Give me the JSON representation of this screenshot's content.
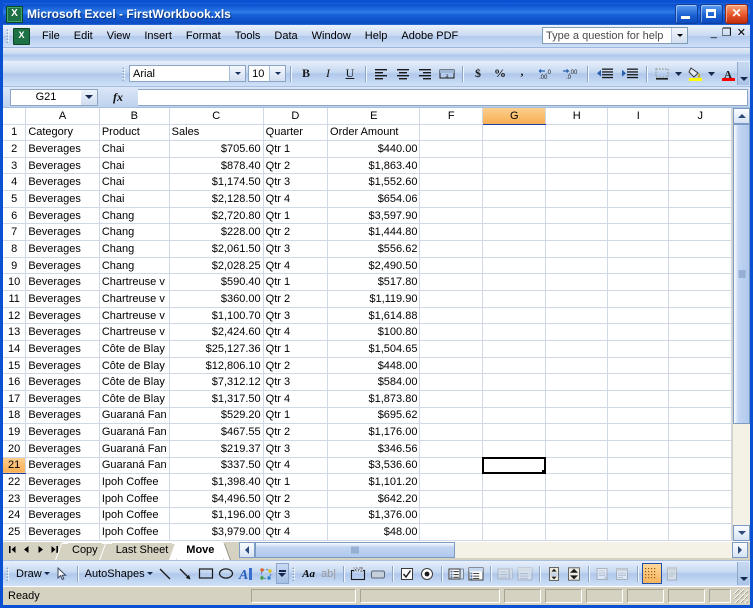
{
  "window": {
    "title": "Microsoft Excel - FirstWorkbook.xls",
    "app_icon": "excel-icon",
    "minimize_label": "Minimize",
    "maximize_label": "Restore",
    "close_label": "Close"
  },
  "menubar": {
    "items": [
      {
        "label": "File"
      },
      {
        "label": "Edit"
      },
      {
        "label": "View"
      },
      {
        "label": "Insert"
      },
      {
        "label": "Format"
      },
      {
        "label": "Tools"
      },
      {
        "label": "Data"
      },
      {
        "label": "Window"
      },
      {
        "label": "Help"
      },
      {
        "label": "Adobe PDF"
      }
    ],
    "help_box_placeholder": "Type a question for help",
    "doc_minimize": "_",
    "doc_restore": "❐",
    "doc_close": "✕"
  },
  "formatting_toolbar": {
    "font_name": "Arial",
    "font_size": "10",
    "buttons": [
      {
        "name": "bold-button",
        "glyph": "B"
      },
      {
        "name": "italic-button",
        "glyph": "I"
      },
      {
        "name": "underline-button",
        "glyph": "U"
      },
      {
        "name": "align-left-button",
        "glyph": "≡"
      },
      {
        "name": "align-center-button",
        "glyph": "≡"
      },
      {
        "name": "align-right-button",
        "glyph": "≡"
      },
      {
        "name": "merge-and-center-button",
        "glyph": "a"
      },
      {
        "name": "currency-style-button",
        "glyph": "$"
      },
      {
        "name": "percent-style-button",
        "glyph": "%"
      },
      {
        "name": "comma-style-button",
        "glyph": ","
      },
      {
        "name": "increase-decimal-button",
        "glyph": ".00"
      },
      {
        "name": "decrease-decimal-button",
        "glyph": ".0"
      },
      {
        "name": "decrease-indent-button",
        "glyph": "←"
      },
      {
        "name": "increase-indent-button",
        "glyph": "→"
      },
      {
        "name": "borders-button",
        "glyph": "▦"
      },
      {
        "name": "fill-color-button",
        "glyph": "△"
      },
      {
        "name": "font-color-button",
        "glyph": "A"
      }
    ]
  },
  "formula_bar": {
    "name_box_value": "G21",
    "fx_label": "fx",
    "formula_value": ""
  },
  "sheet": {
    "columns": [
      "A",
      "B",
      "C",
      "D",
      "E",
      "F",
      "G",
      "H",
      "I",
      "J"
    ],
    "selected_column": "G",
    "selected_row": "21",
    "selected_cell": "G21",
    "header_row": {
      "row_number": "1",
      "cells": [
        "Category",
        "Product",
        "Sales",
        "Quarter",
        "Order Amount",
        "",
        "",
        "",
        "",
        ""
      ]
    },
    "rows": [
      {
        "n": "2",
        "a": "Beverages",
        "b": "Chai",
        "c": "$705.60",
        "d": "Qtr 1",
        "e": "$440.00"
      },
      {
        "n": "3",
        "a": "Beverages",
        "b": "Chai",
        "c": "$878.40",
        "d": "Qtr 2",
        "e": "$1,863.40"
      },
      {
        "n": "4",
        "a": "Beverages",
        "b": "Chai",
        "c": "$1,174.50",
        "d": "Qtr 3",
        "e": "$1,552.60"
      },
      {
        "n": "5",
        "a": "Beverages",
        "b": "Chai",
        "c": "$2,128.50",
        "d": "Qtr 4",
        "e": "$654.06"
      },
      {
        "n": "6",
        "a": "Beverages",
        "b": "Chang",
        "c": "$2,720.80",
        "d": "Qtr 1",
        "e": "$3,597.90"
      },
      {
        "n": "7",
        "a": "Beverages",
        "b": "Chang",
        "c": "$228.00",
        "d": "Qtr 2",
        "e": "$1,444.80"
      },
      {
        "n": "8",
        "a": "Beverages",
        "b": "Chang",
        "c": "$2,061.50",
        "d": "Qtr 3",
        "e": "$556.62"
      },
      {
        "n": "9",
        "a": "Beverages",
        "b": "Chang",
        "c": "$2,028.25",
        "d": "Qtr 4",
        "e": "$2,490.50"
      },
      {
        "n": "10",
        "a": "Beverages",
        "b": "Chartreuse v",
        "c": "$590.40",
        "d": "Qtr 1",
        "e": "$517.80"
      },
      {
        "n": "11",
        "a": "Beverages",
        "b": "Chartreuse v",
        "c": "$360.00",
        "d": "Qtr 2",
        "e": "$1,119.90"
      },
      {
        "n": "12",
        "a": "Beverages",
        "b": "Chartreuse v",
        "c": "$1,100.70",
        "d": "Qtr 3",
        "e": "$1,614.88"
      },
      {
        "n": "13",
        "a": "Beverages",
        "b": "Chartreuse v",
        "c": "$2,424.60",
        "d": "Qtr 4",
        "e": "$100.80"
      },
      {
        "n": "14",
        "a": "Beverages",
        "b": "Côte de Blay",
        "c": "$25,127.36",
        "d": "Qtr 1",
        "e": "$1,504.65"
      },
      {
        "n": "15",
        "a": "Beverages",
        "b": "Côte de Blay",
        "c": "$12,806.10",
        "d": "Qtr 2",
        "e": "$448.00"
      },
      {
        "n": "16",
        "a": "Beverages",
        "b": "Côte de Blay",
        "c": "$7,312.12",
        "d": "Qtr 3",
        "e": "$584.00"
      },
      {
        "n": "17",
        "a": "Beverages",
        "b": "Côte de Blay",
        "c": "$1,317.50",
        "d": "Qtr 4",
        "e": "$1,873.80"
      },
      {
        "n": "18",
        "a": "Beverages",
        "b": "Guaraná Fan",
        "c": "$529.20",
        "d": "Qtr 1",
        "e": "$695.62"
      },
      {
        "n": "19",
        "a": "Beverages",
        "b": "Guaraná Fan",
        "c": "$467.55",
        "d": "Qtr 2",
        "e": "$1,176.00"
      },
      {
        "n": "20",
        "a": "Beverages",
        "b": "Guaraná Fan",
        "c": "$219.37",
        "d": "Qtr 3",
        "e": "$346.56"
      },
      {
        "n": "21",
        "a": "Beverages",
        "b": "Guaraná Fan",
        "c": "$337.50",
        "d": "Qtr 4",
        "e": "$3,536.60"
      },
      {
        "n": "22",
        "a": "Beverages",
        "b": "Ipoh Coffee",
        "c": "$1,398.40",
        "d": "Qtr 1",
        "e": "$1,101.20"
      },
      {
        "n": "23",
        "a": "Beverages",
        "b": "Ipoh Coffee",
        "c": "$4,496.50",
        "d": "Qtr 2",
        "e": "$642.20"
      },
      {
        "n": "24",
        "a": "Beverages",
        "b": "Ipoh Coffee",
        "c": "$1,196.00",
        "d": "Qtr 3",
        "e": "$1,376.00"
      },
      {
        "n": "25",
        "a": "Beverages",
        "b": "Ipoh Coffee",
        "c": "$3,979.00",
        "d": "Qtr 4",
        "e": "$48.00"
      }
    ]
  },
  "sheet_tabs": {
    "nav_first": "⏮",
    "nav_prev": "◀",
    "nav_next": "▶",
    "nav_last": "⏭",
    "tabs": [
      {
        "label": "Copy",
        "active": false
      },
      {
        "label": "Last Sheet",
        "active": false
      },
      {
        "label": "Move",
        "active": true
      }
    ]
  },
  "drawing_toolbar": {
    "draw_label": "Draw",
    "autoshapes_label": "AutoShapes",
    "buttons": [
      {
        "name": "select-objects-icon"
      },
      {
        "name": "line-icon"
      },
      {
        "name": "arrow-icon"
      },
      {
        "name": "rectangle-icon"
      },
      {
        "name": "oval-icon"
      },
      {
        "name": "wordart-icon"
      },
      {
        "name": "diagram-icon"
      }
    ]
  },
  "forms_toolbar": {
    "buttons": [
      {
        "name": "label-icon",
        "glyph": "Aa"
      },
      {
        "name": "edit-box-icon",
        "glyph": "ab|"
      },
      {
        "name": "group-box-icon"
      },
      {
        "name": "button-icon"
      },
      {
        "name": "check-box-icon"
      },
      {
        "name": "option-button-icon"
      },
      {
        "name": "list-box-icon"
      },
      {
        "name": "combo-box-icon"
      },
      {
        "name": "combination-list-edit-icon"
      },
      {
        "name": "combination-drop-down-edit-icon"
      },
      {
        "name": "scroll-bar-icon"
      },
      {
        "name": "spinner-icon"
      },
      {
        "name": "control-properties-icon"
      },
      {
        "name": "edit-code-icon"
      },
      {
        "name": "toggle-grid-icon"
      },
      {
        "name": "run-dialog-icon"
      }
    ]
  },
  "statusbar": {
    "message": "Ready"
  }
}
